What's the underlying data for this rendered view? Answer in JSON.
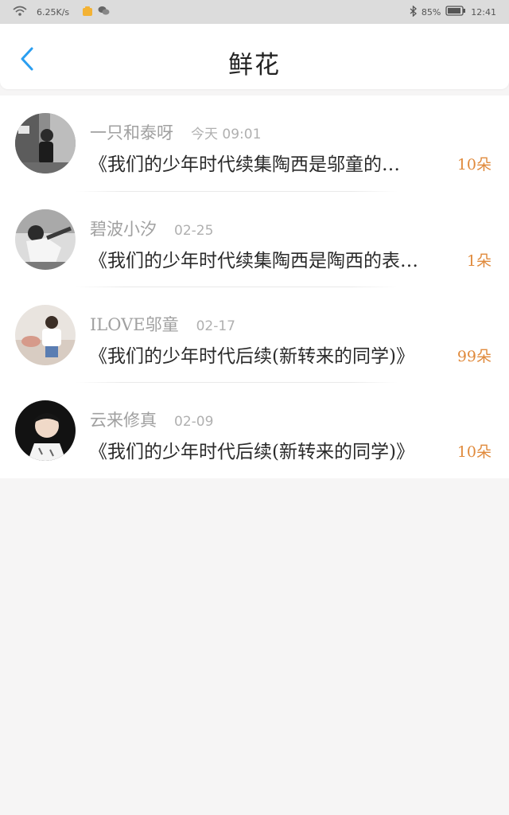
{
  "status_bar": {
    "speed": "6.25K/s",
    "battery": "85%",
    "time": "12:41"
  },
  "header": {
    "title": "鲜花"
  },
  "list": [
    {
      "username": "一只和泰呀",
      "time": "今天 09:01",
      "work": "《我们的少年时代续集陶西是邬童的…",
      "flowers": "10朵"
    },
    {
      "username": "碧波小汐",
      "time": "02-25",
      "work": "《我们的少年时代续集陶西是陶西的表…",
      "flowers": "1朵"
    },
    {
      "username": "ILOVE邬童",
      "time": "02-17",
      "work": "《我们的少年时代后续(新转来的同学)》",
      "flowers": "99朵"
    },
    {
      "username": "云来修真",
      "time": "02-09",
      "work": "《我们的少年时代后续(新转来的同学)》",
      "flowers": "10朵"
    }
  ],
  "colors": {
    "accent": "#2a9ef0",
    "flowers": "#e08a3c"
  }
}
